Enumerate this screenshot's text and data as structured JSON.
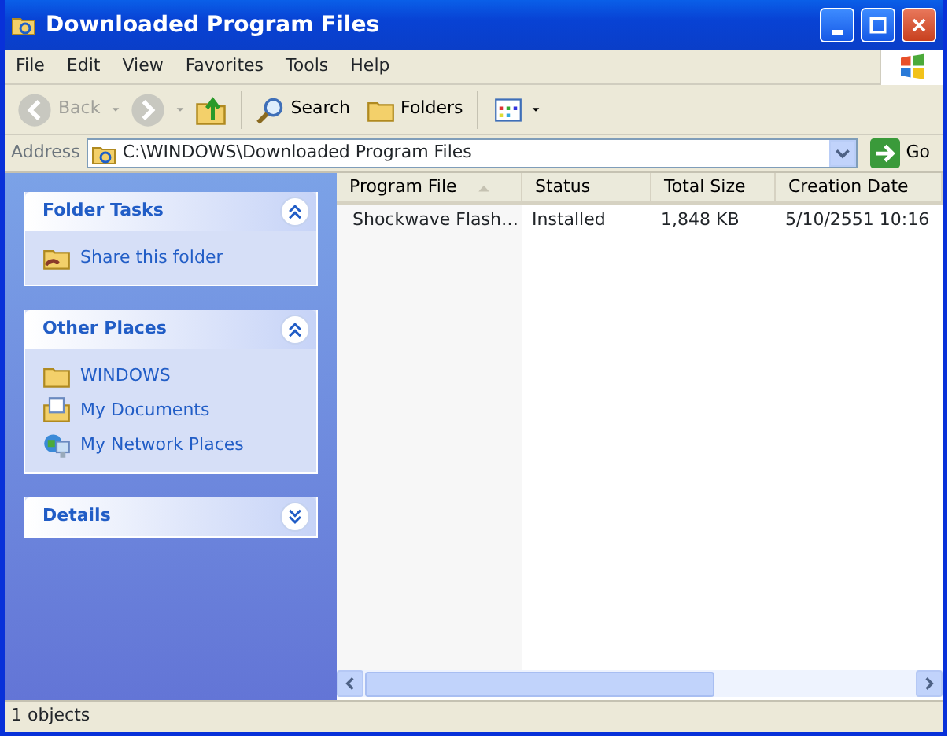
{
  "window": {
    "title": "Downloaded Program Files"
  },
  "menu": [
    "File",
    "Edit",
    "View",
    "Favorites",
    "Tools",
    "Help"
  ],
  "toolbar": [
    {
      "kind": "back",
      "label": "Back",
      "disabled": true
    },
    {
      "kind": "forward",
      "disabled": true
    },
    {
      "kind": "up"
    },
    {
      "kind": "search",
      "label": "Search"
    },
    {
      "kind": "folders",
      "label": "Folders"
    },
    {
      "kind": "views"
    }
  ],
  "address": {
    "label": "Address",
    "value": "C:\\WINDOWS\\Downloaded Program Files",
    "go": "Go"
  },
  "task_panels": [
    {
      "title": "Folder Tasks",
      "expanded": true,
      "items": [
        {
          "kind": "share",
          "label": "Share this folder"
        }
      ]
    },
    {
      "title": "Other Places",
      "expanded": true,
      "items": [
        {
          "kind": "folder",
          "label": "WINDOWS"
        },
        {
          "kind": "documents",
          "label": "My Documents"
        },
        {
          "kind": "network",
          "label": "My Network Places"
        }
      ]
    },
    {
      "title": "Details",
      "expanded": false
    }
  ],
  "table": {
    "columns": [
      {
        "label": "Program File",
        "sorted": true
      },
      {
        "label": "Status",
        "sorted": false
      },
      {
        "label": "Total Size",
        "sorted": false
      },
      {
        "label": "Creation Date",
        "sorted": false
      }
    ],
    "rows": [
      {
        "cells": [
          "Shockwave Flash…",
          "Installed",
          "1,848 KB",
          "5/10/2551 10:16"
        ],
        "selected": false
      }
    ]
  },
  "status_bar": "1 objects"
}
